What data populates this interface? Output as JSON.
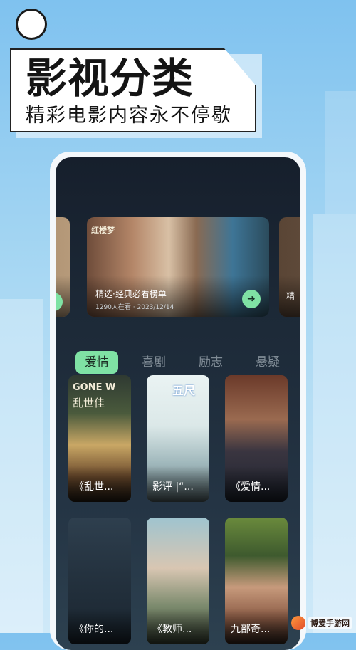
{
  "header": {
    "title": "影视分类",
    "subtitle": "精彩电影内容永不停歇"
  },
  "banner": {
    "title": "精选·经典必看榜单",
    "meta": "1290人在看 · 2023/12/14",
    "side_right_text": "精",
    "poster_text_top": "红楼梦"
  },
  "tabs": [
    {
      "label": "爱情",
      "active": true
    },
    {
      "label": "喜剧",
      "active": false
    },
    {
      "label": "励志",
      "active": false
    },
    {
      "label": "悬疑",
      "active": false
    }
  ],
  "cards": [
    {
      "label": "《乱世...",
      "poster_title": "GONE W",
      "poster_cn": "乱世佳"
    },
    {
      "label": "影评 |“...",
      "poster_title": "五尺"
    },
    {
      "label": "《爱情..."
    },
    {
      "label": "《你的..."
    },
    {
      "label": "《教师..."
    },
    {
      "label": "九部奇..."
    }
  ],
  "watermark": {
    "text": "博爱手游网"
  },
  "colors": {
    "accent": "#7fe2a4",
    "background": "#a9d8f3",
    "screen": "#1d2a38"
  }
}
